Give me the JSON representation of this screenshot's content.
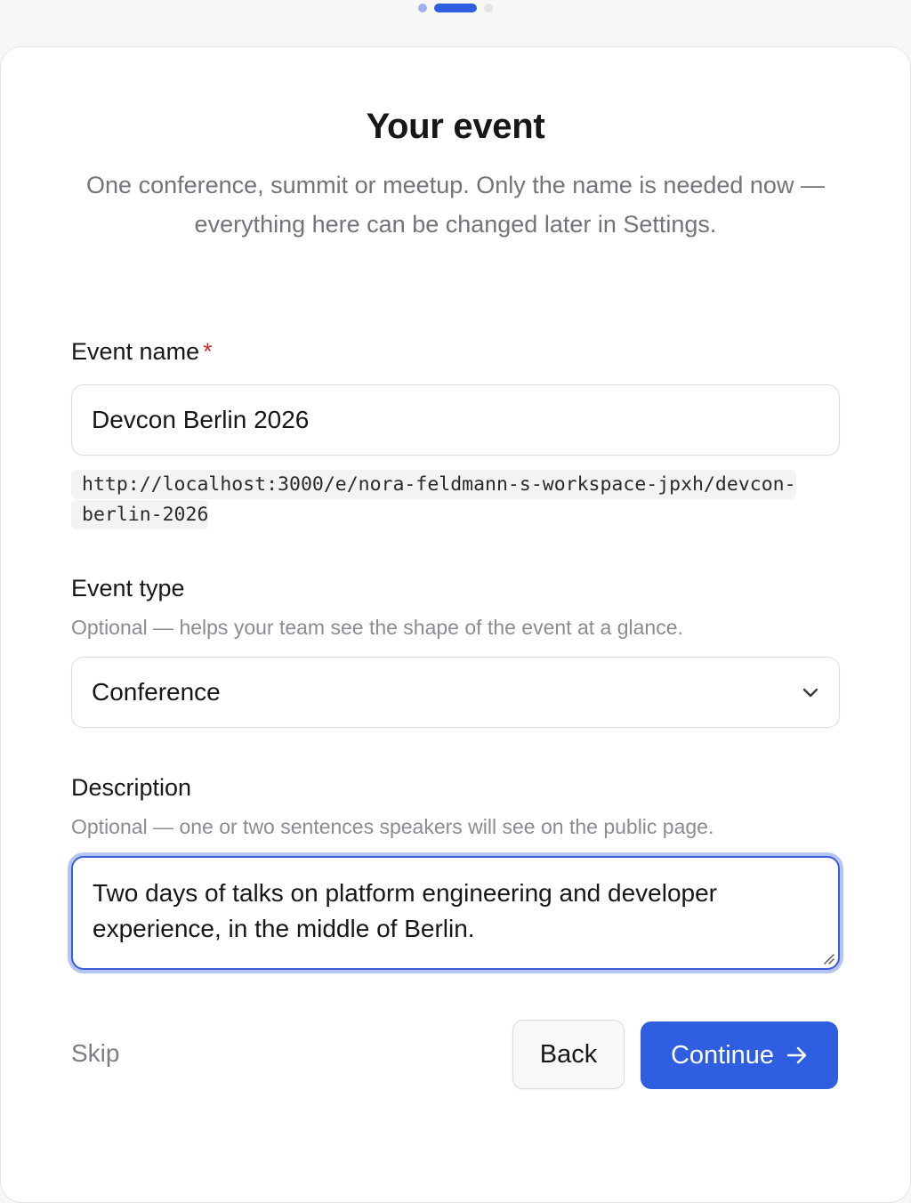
{
  "stepper": {
    "total_steps": 3,
    "current_step": 2
  },
  "page": {
    "title": "Your event",
    "subtitle": "One conference, summit or meetup. Only the name is needed now — everything here can be changed later in Settings."
  },
  "event_name": {
    "label": "Event name",
    "required_marker": "*",
    "value": "Devcon Berlin 2026",
    "url_preview": "http://localhost:3000/e/nora-feldmann-s-workspace-jpxh/devcon-berlin-2026"
  },
  "event_type": {
    "label": "Event type",
    "hint": "Optional — helps your team see the shape of the event at a glance.",
    "selected": "Conference",
    "icon": "chevron-down-icon"
  },
  "description": {
    "label": "Description",
    "hint": "Optional — one or two sentences speakers will see on the public page.",
    "value": "Two days of talks on platform engineering and developer experience, in the middle of Berlin."
  },
  "actions": {
    "skip_label": "Skip",
    "back_label": "Back",
    "continue_label": "Continue",
    "continue_icon": "arrow-right-icon"
  },
  "colors": {
    "accent": "#2f5fe0",
    "required": "#d62a2a",
    "focus_ring": "#7894ec"
  }
}
